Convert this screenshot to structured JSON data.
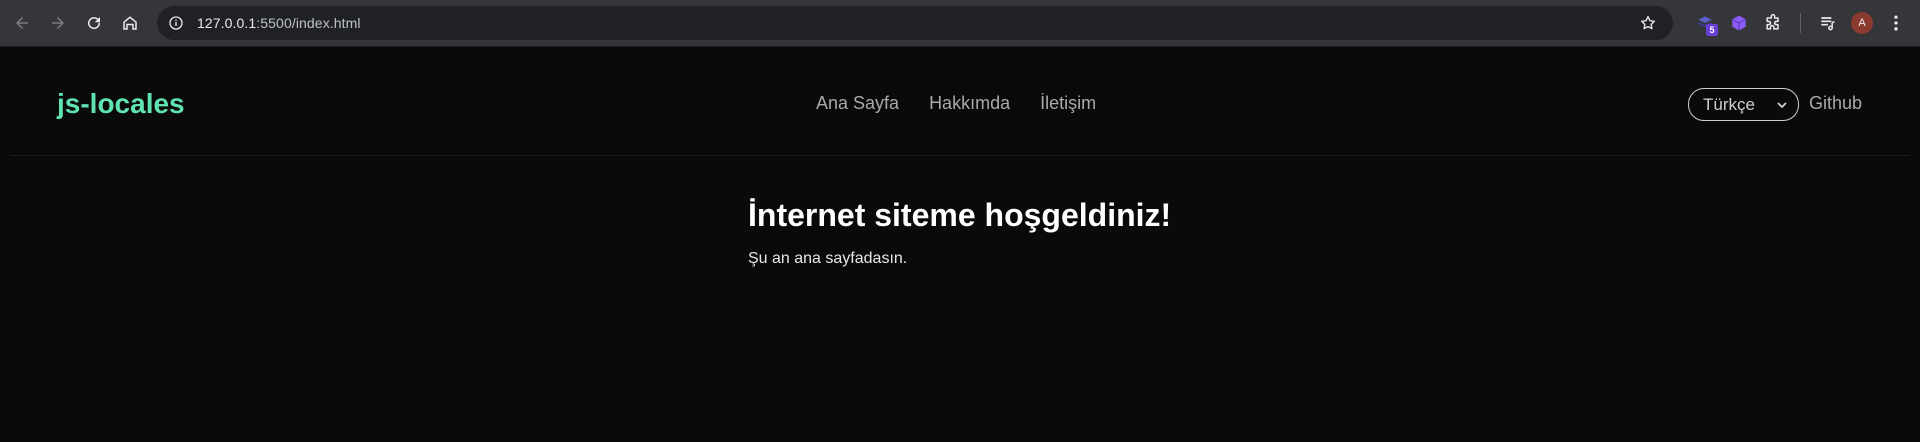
{
  "browser": {
    "url_host": "127.0.0.1",
    "url_path": ":5500/index.html",
    "extension_badge": "5",
    "avatar_initial": "A"
  },
  "site": {
    "logo": "js-locales",
    "nav": [
      "Ana Sayfa",
      "Hakkımda",
      "İletişim"
    ],
    "language_selected": "Türkçe",
    "github_label": "Github"
  },
  "main": {
    "heading": "İnternet siteme hoşgeldiniz!",
    "text": "Şu an ana sayfadasın."
  },
  "colors": {
    "logo": "#5fe3b0",
    "background": "#0a0a0a",
    "toolbar": "#35363a"
  }
}
